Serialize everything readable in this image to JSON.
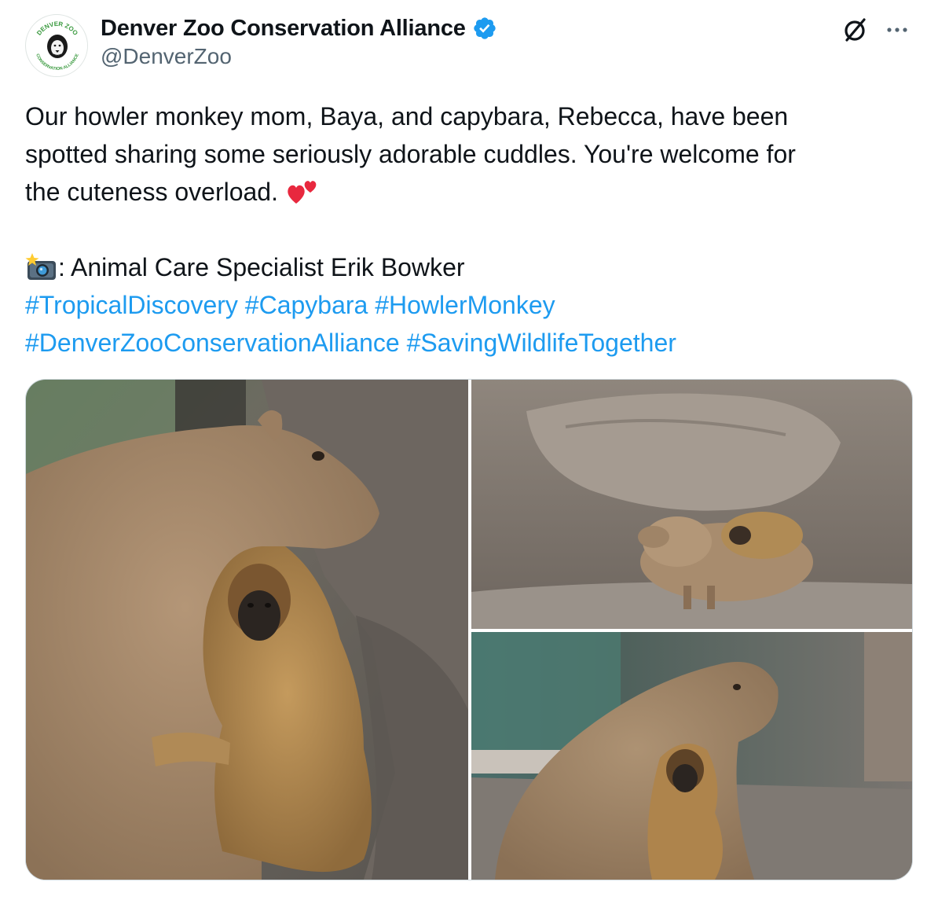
{
  "author": {
    "display_name": "Denver Zoo Conservation Alliance",
    "handle": "@DenverZoo",
    "avatar_text_top": "DENVER ZOO",
    "avatar_text_bottom": "CONSERVATION ALLIANCE",
    "verified_icon": "verified-badge-icon"
  },
  "actions": {
    "grok_icon": "grok-icon",
    "more_icon": "more-icon",
    "more_label": "···"
  },
  "tweet": {
    "line1": "Our howler monkey mom, Baya, and capybara, Rebecca, have been",
    "line2": "spotted sharing some seriously adorable cuddles. You're welcome for",
    "line3_text": "the cuteness overload. ",
    "line3_emoji": "two-hearts-emoji",
    "credit_emoji": "camera-flash-emoji",
    "credit_text": ": Animal Care Specialist Erik Bowker",
    "hashtags_line1": [
      "#TropicalDiscovery",
      "#Capybara",
      "#HowlerMonkey"
    ],
    "hashtags_line2": [
      "#DenverZooConservationAlliance",
      "#SavingWildlifeTogether"
    ]
  },
  "media": {
    "photo_count": 3,
    "photos": [
      "capybara-and-howler-monkey-closeup",
      "capybara-and-monkey-under-rock",
      "capybara-and-monkey-in-enclosure"
    ]
  },
  "colors": {
    "link": "#1d9bf0",
    "verified": "#1d9bf0",
    "secondary_text": "#536471"
  }
}
